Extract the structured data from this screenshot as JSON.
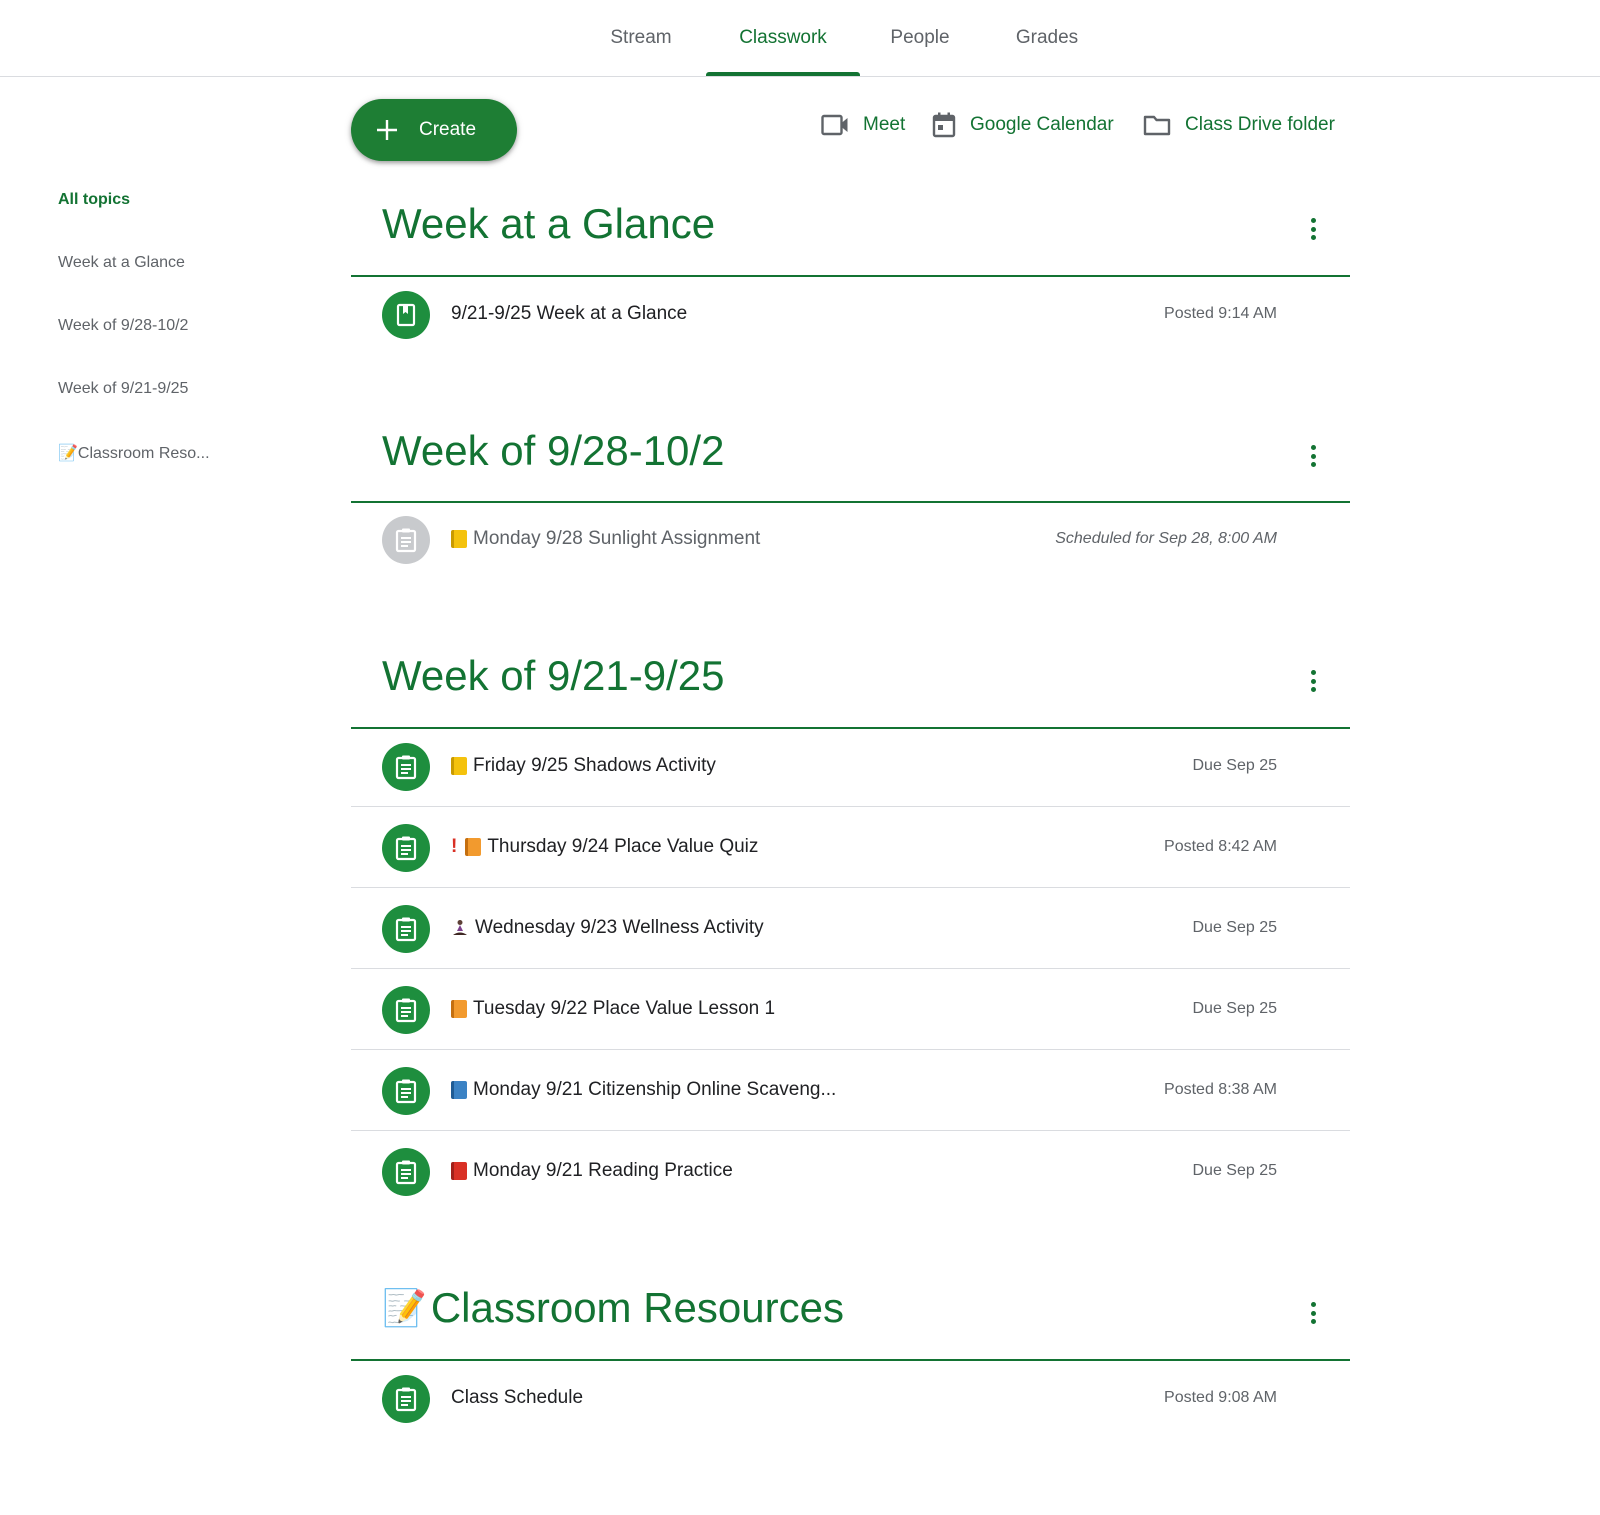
{
  "tabs": [
    {
      "label": "Stream",
      "active": false
    },
    {
      "label": "Classwork",
      "active": true
    },
    {
      "label": "People",
      "active": false
    },
    {
      "label": "Grades",
      "active": false
    }
  ],
  "sidebar": {
    "items": [
      {
        "label": "All topics",
        "active": true
      },
      {
        "label": "Week at a Glance"
      },
      {
        "label": "Week of 9/28-10/2"
      },
      {
        "label": "Week of 9/21-9/25"
      },
      {
        "label": "📝Classroom Reso..."
      }
    ]
  },
  "toolbar": {
    "create_label": "Create",
    "meet_label": "Meet",
    "calendar_label": "Google Calendar",
    "drive_label": "Class Drive folder"
  },
  "topics": [
    {
      "title": "Week at a Glance",
      "items": [
        {
          "title": "9/21-9/25 Week at a Glance",
          "meta": "Posted 9:14 AM",
          "icon": "material-icon"
        }
      ]
    },
    {
      "title": "Week of 9/28-10/2",
      "items": [
        {
          "title": "Monday 9/28 Sunlight Assignment",
          "meta": "Scheduled for Sep 28, 8:00 AM",
          "icon": "assignment-icon",
          "emoji": "yellow-notebook",
          "scheduled": true
        }
      ]
    },
    {
      "title": "Week of 9/21-9/25",
      "items": [
        {
          "title": "Friday 9/25 Shadows Activity",
          "meta": "Due Sep 25",
          "icon": "assignment-icon",
          "emoji": "yellow-notebook"
        },
        {
          "title": "Thursday 9/24 Place Value Quiz",
          "meta": "Posted 8:42 AM",
          "icon": "assignment-icon",
          "prefix": "!",
          "emoji": "orange-book"
        },
        {
          "title": "Wednesday 9/23 Wellness Activity",
          "meta": "Due Sep 25",
          "icon": "assignment-icon",
          "emoji": "meditation"
        },
        {
          "title": "Tuesday 9/22 Place Value Lesson 1",
          "meta": "Due Sep 25",
          "icon": "assignment-icon",
          "emoji": "orange-book"
        },
        {
          "title": "Monday 9/21 Citizenship Online Scaveng...",
          "meta": "Posted 8:38 AM",
          "icon": "assignment-icon",
          "emoji": "blue-book"
        },
        {
          "title": "Monday 9/21 Reading Practice",
          "meta": "Due Sep 25",
          "icon": "assignment-icon",
          "emoji": "red-book"
        }
      ]
    },
    {
      "title": "Classroom Resources",
      "title_emoji": "📝",
      "items": [
        {
          "title": "Class Schedule",
          "meta": "Posted 9:08 AM",
          "icon": "assignment-icon"
        }
      ]
    }
  ],
  "colors": {
    "brand_green": "#137333",
    "icon_green": "#1e8e3e",
    "scheduled_grey": "#c8cacd",
    "divider": "#dadce0"
  }
}
